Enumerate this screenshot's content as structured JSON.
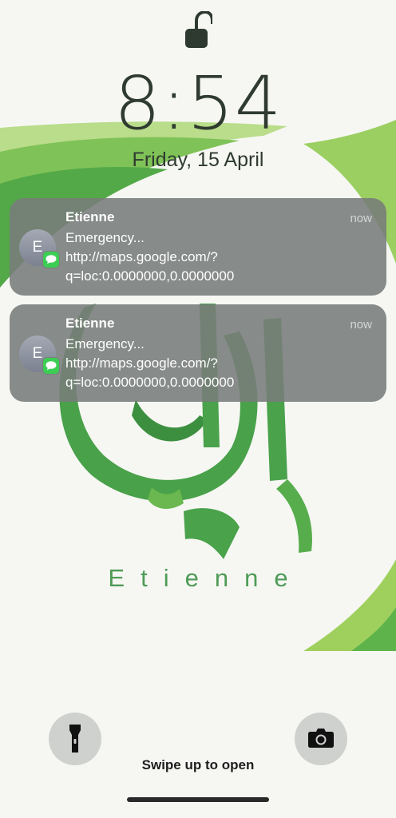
{
  "lockscreen": {
    "time": "8:54",
    "date": "Friday, 15 April",
    "swipe_hint": "Swipe up to open",
    "lock_state": "unlocked"
  },
  "wallpaper": {
    "brand_text": "Etienne",
    "colors": {
      "green_dark": "#3f9a45",
      "green_light": "#9fd05e",
      "background": "#f6f7f3"
    }
  },
  "notifications": [
    {
      "avatar_initial": "E",
      "sender": "Etienne",
      "time": "now",
      "line1": "Emergency...",
      "line2": "http://maps.google.com/?",
      "line3": "q=loc:0.0000000,0.0000000",
      "app_icon": "messages-icon"
    },
    {
      "avatar_initial": "E",
      "sender": "Etienne",
      "time": "now",
      "line1": "Emergency...",
      "line2": "http://maps.google.com/?",
      "line3": "q=loc:0.0000000,0.0000000",
      "app_icon": "messages-icon"
    }
  ],
  "quick_actions": {
    "left_icon": "flashlight-icon",
    "right_icon": "camera-icon"
  }
}
